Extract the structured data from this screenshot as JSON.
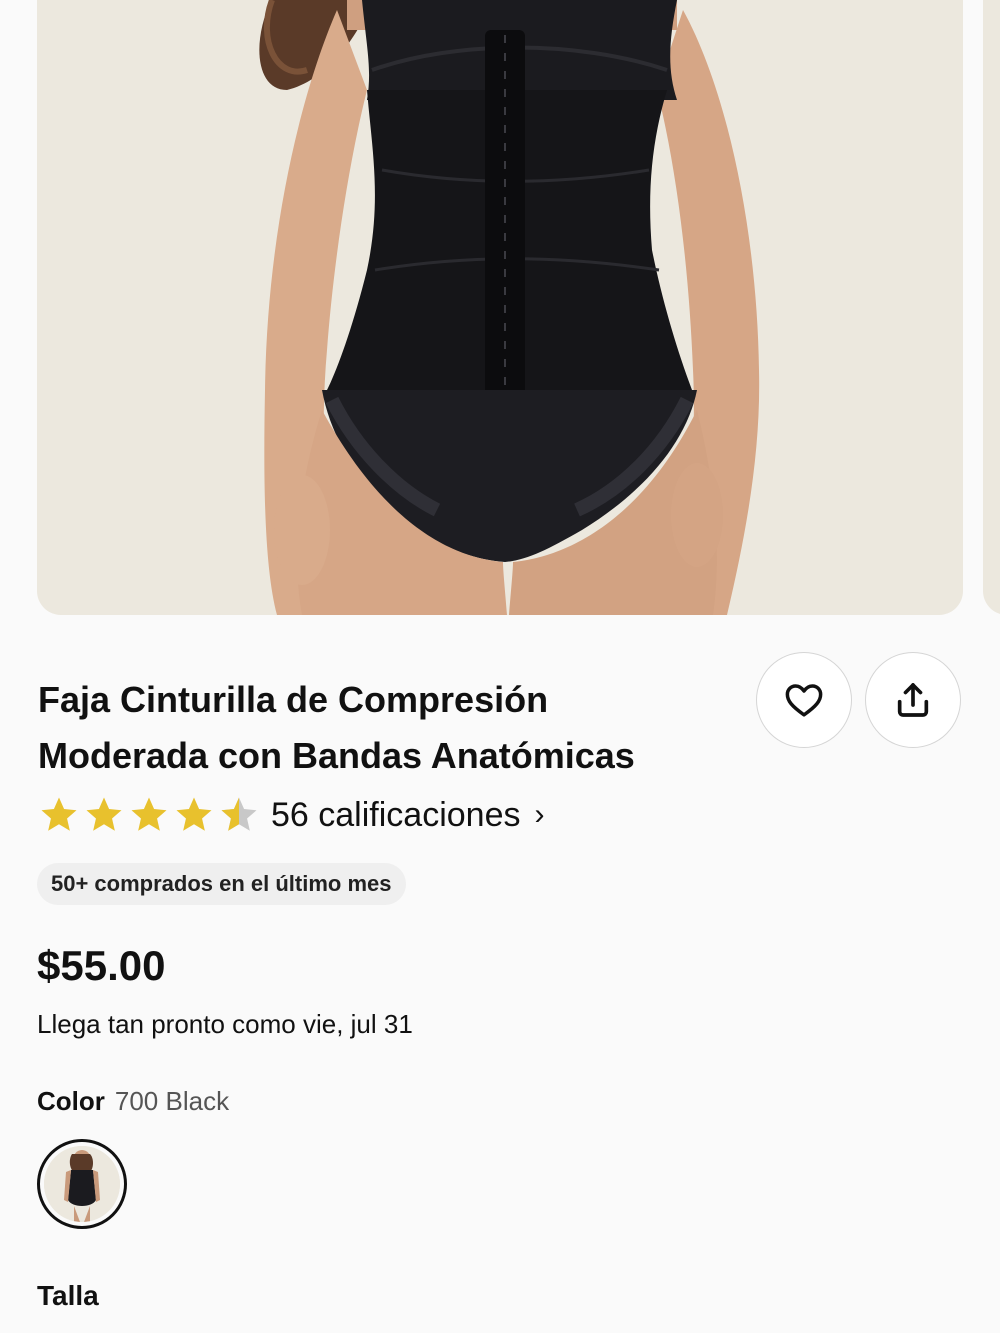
{
  "product": {
    "title": "Faja Cinturilla de Compresión Moderada con Bandas Anatómicas",
    "rating": 4.5,
    "rating_max": 5,
    "rating_count_text": "56 calificaciones",
    "rating_chevron": "›",
    "purchased_badge": "50+ comprados en el último mes",
    "price": "$55.00",
    "delivery": "Llega tan pronto como vie, jul 31"
  },
  "actions": {
    "favorite_icon": "heart-icon",
    "share_icon": "share-icon"
  },
  "variants": {
    "color_label": "Color",
    "color_value": "700 Black",
    "size_label": "Talla"
  },
  "colors": {
    "star_filled": "#e8c12d",
    "star_empty": "#c8c8c8",
    "photo_background": "#ece8de",
    "garment": "#1b1b1f"
  }
}
